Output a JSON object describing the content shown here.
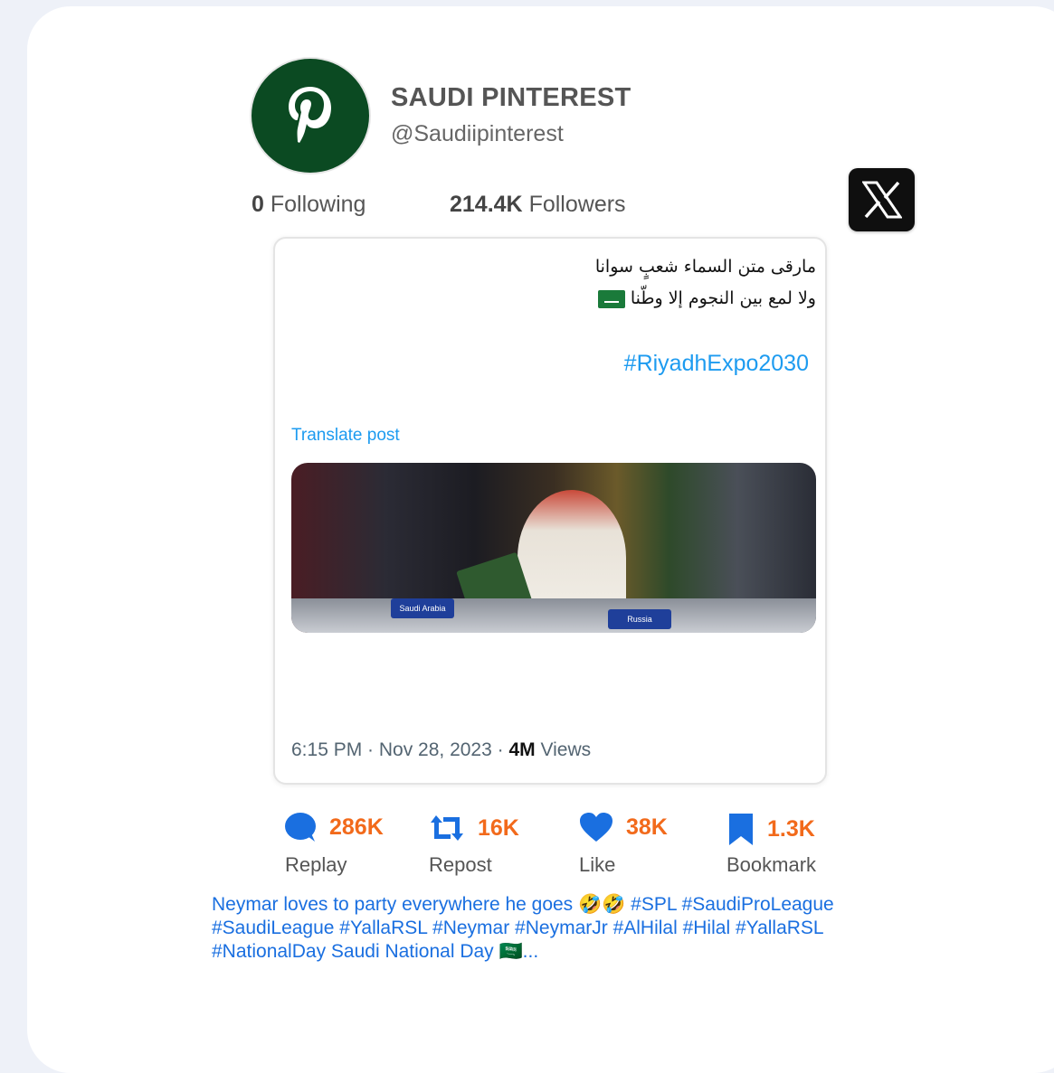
{
  "profile": {
    "name": "SAUDI PINTEREST",
    "handle": "@Saudiipinterest",
    "following_count": "0",
    "following_label": "Following",
    "followers_count": "214.4K",
    "followers_label": "Followers"
  },
  "post": {
    "arabic_line1": "مارقى متن السماء شعبٍ سوانا",
    "arabic_line2": "ولا لمع بين النجوم إلا وطّنا",
    "hashtag": "#RiyadhExpo2030",
    "translate_label": "Translate post",
    "photo_plate_left": "Saudi Arabia",
    "photo_plate_right": "Russia",
    "timestamp": "6:15 PM · Nov 28, 2023 · ",
    "views_count": "4M",
    "views_label": " Views"
  },
  "actions": [
    {
      "count": "286K",
      "label": "Replay",
      "icon": "reply-bubble-icon"
    },
    {
      "count": "16K",
      "label": "Repost",
      "icon": "repost-icon"
    },
    {
      "count": "38K",
      "label": "Like",
      "icon": "heart-icon"
    },
    {
      "count": "1.3K",
      "label": "Bookmark",
      "icon": "bookmark-icon"
    }
  ],
  "caption": "Neymar loves to party everywhere he goes 🤣🤣 #SPL #SaudiProLeague #SaudiLeague #YallaRSL #Neymar #NeymarJr #AlHilal #Hilal #YallaRSL #NationalDay Saudi National Day 🇸🇦...",
  "colors": {
    "accent_orange": "#f26a1b",
    "icon_blue": "#1a6fe0",
    "link_blue": "#1d9bf0",
    "avatar_green": "#0b4a22"
  }
}
